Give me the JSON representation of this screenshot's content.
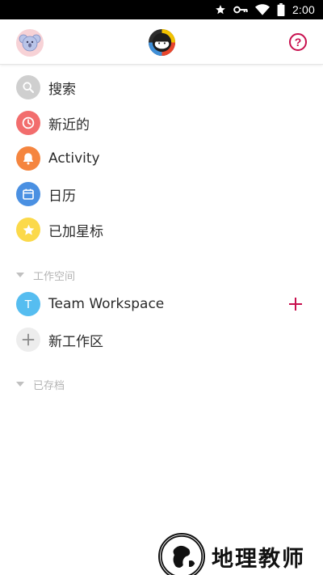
{
  "status_bar": {
    "time": "2:00"
  },
  "top_bar": {
    "help_label": "?"
  },
  "menu": {
    "items": [
      {
        "label": "搜索",
        "icon": "search-icon",
        "color": "#cfcfcf"
      },
      {
        "label": "新近的",
        "icon": "clock-icon",
        "color": "#f26d6d"
      },
      {
        "label": "Activity",
        "icon": "bell-icon",
        "color": "#f5853f"
      },
      {
        "label": "日历",
        "icon": "calendar-icon",
        "color": "#4a90e2"
      },
      {
        "label": "已加星标",
        "icon": "star-icon",
        "color": "#fbd94a"
      }
    ]
  },
  "workspaces": {
    "header": "工作空间",
    "items": [
      {
        "initial": "T",
        "label": "Team Workspace",
        "color": "#56bdf0"
      }
    ],
    "add_label": "新工作区",
    "accent": "#c8104e"
  },
  "archived": {
    "header": "已存档"
  },
  "watermark": {
    "text": "地理教师"
  }
}
